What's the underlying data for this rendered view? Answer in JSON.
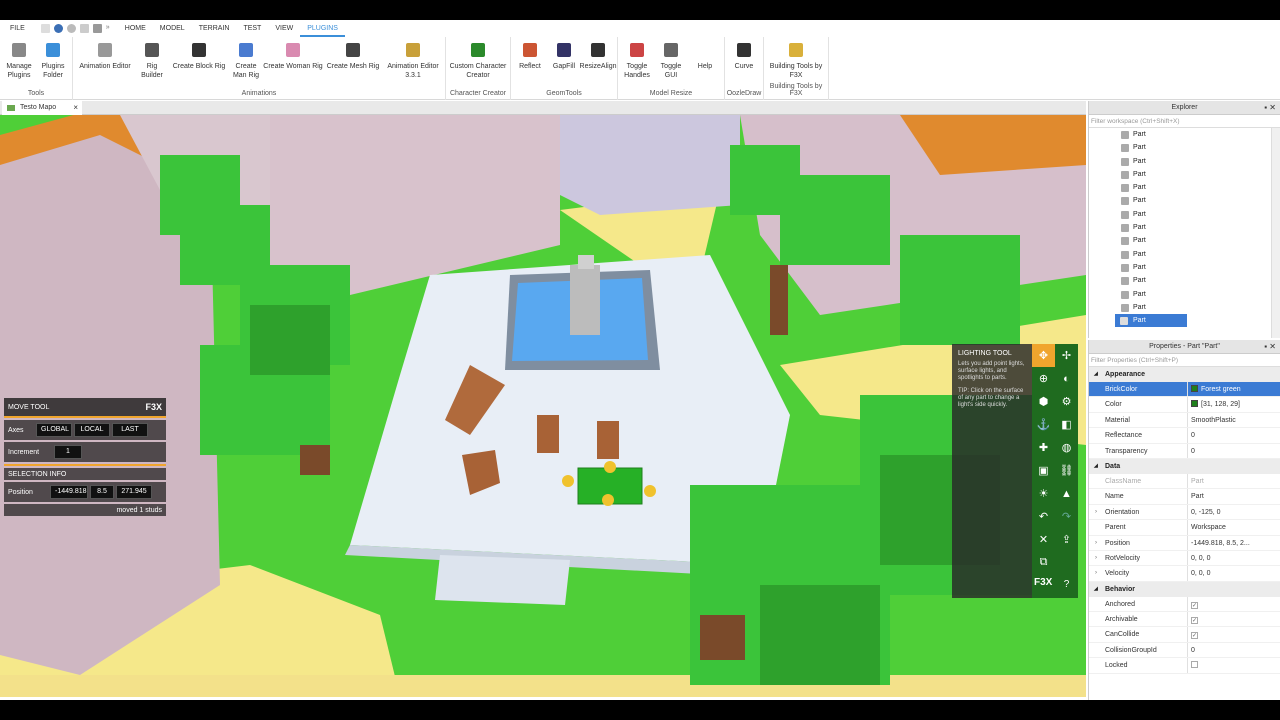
{
  "menu": {
    "file": "FILE",
    "tabs": [
      "HOME",
      "MODEL",
      "TERRAIN",
      "TEST",
      "VIEW",
      "PLUGINS"
    ],
    "active": "PLUGINS"
  },
  "ribbon": {
    "groups": [
      {
        "name": "Tools",
        "buttons": [
          {
            "label": "Manage Plugins",
            "icon": "gear-icon"
          },
          {
            "label": "Plugins Folder",
            "icon": "folder-icon"
          }
        ]
      },
      {
        "name": "Animations",
        "buttons": [
          {
            "label": "Animation Editor",
            "icon": "animation-icon"
          },
          {
            "label": "Rig Builder",
            "icon": "rig-icon"
          },
          {
            "label": "Create Block Rig",
            "icon": "block-rig-icon"
          },
          {
            "label": "Create Man Rig",
            "icon": "man-rig-icon"
          },
          {
            "label": "Create Woman Rig",
            "icon": "woman-rig-icon"
          },
          {
            "label": "Create Mesh Rig",
            "icon": "mesh-rig-icon"
          },
          {
            "label": "Animation Editor 3.3.1",
            "icon": "animation-editor-icon"
          }
        ]
      },
      {
        "name": "Character Creator",
        "buttons": [
          {
            "label": "Custom Character Creator",
            "icon": "character-icon"
          }
        ]
      },
      {
        "name": "GeomTools",
        "buttons": [
          {
            "label": "Reflect",
            "icon": "reflect-icon"
          },
          {
            "label": "GapFill",
            "icon": "gapfill-icon"
          },
          {
            "label": "ResizeAlign",
            "icon": "resize-align-icon"
          }
        ]
      },
      {
        "name": "Model Resize",
        "buttons": [
          {
            "label": "Toggle Handles",
            "icon": "handles-icon"
          },
          {
            "label": "Toggle GUI",
            "icon": "gui-icon"
          },
          {
            "label": "Help",
            "icon": "help-icon"
          }
        ]
      },
      {
        "name": "OozleDraw",
        "buttons": [
          {
            "label": "Curve",
            "icon": "curve-icon"
          }
        ]
      },
      {
        "name": "Building Tools by F3X",
        "buttons": [
          {
            "label": "Building Tools by F3X",
            "icon": "f3x-icon"
          }
        ]
      }
    ]
  },
  "doc_tab": {
    "label": "Testo Mapo",
    "close": "×"
  },
  "move_tool": {
    "title": "MOVE TOOL",
    "brand": "F3X",
    "axes_label": "Axes",
    "axes": [
      "GLOBAL",
      "LOCAL",
      "LAST"
    ],
    "increment_label": "Increment",
    "increment": "1",
    "selection_info": "SELECTION INFO",
    "position_label": "Position",
    "position": [
      "-1449.818",
      "8.5",
      "271.945"
    ],
    "status": "moved 1 studs"
  },
  "lighting_tool": {
    "title": "LIGHTING TOOL",
    "desc": "Lets you add point lights, surface lights, and spotlights to parts.",
    "tip": "TIP: Click on the surface of any part to change a light's side quickly.",
    "brand": "F3X",
    "help": "?"
  },
  "explorer": {
    "title": "Explorer",
    "filter": "Filter workspace (Ctrl+Shift+X)",
    "items": [
      "Part",
      "Part",
      "Part",
      "Part",
      "Part",
      "Part",
      "Part",
      "Part",
      "Part",
      "Part",
      "Part",
      "Part",
      "Part",
      "Part",
      "Part"
    ],
    "selected_index": 14
  },
  "properties": {
    "title": "Properties - Part \"Part\"",
    "filter": "Filter Properties (Ctrl+Shift+P)",
    "sections": [
      {
        "name": "Appearance",
        "rows": [
          {
            "n": "BrickColor",
            "v": "Forest green",
            "swatch": true,
            "sel": true
          },
          {
            "n": "Color",
            "v": "[31, 128, 29]",
            "swatch": true
          },
          {
            "n": "Material",
            "v": "SmoothPlastic"
          },
          {
            "n": "Reflectance",
            "v": "0"
          },
          {
            "n": "Transparency",
            "v": "0"
          }
        ]
      },
      {
        "name": "Data",
        "rows": [
          {
            "n": "ClassName",
            "v": "Part",
            "dim": true
          },
          {
            "n": "Name",
            "v": "Part"
          },
          {
            "n": "Orientation",
            "v": "0, -125, 0",
            "exp": true
          },
          {
            "n": "Parent",
            "v": "Workspace"
          },
          {
            "n": "Position",
            "v": "-1449.818, 8.5, 2...",
            "exp": true
          },
          {
            "n": "RotVelocity",
            "v": "0, 0, 0",
            "exp": true
          },
          {
            "n": "Velocity",
            "v": "0, 0, 0",
            "exp": true
          }
        ]
      },
      {
        "name": "Behavior",
        "rows": [
          {
            "n": "Anchored",
            "chk": true
          },
          {
            "n": "Archivable",
            "chk": true
          },
          {
            "n": "CanCollide",
            "chk": true
          },
          {
            "n": "CollisionGroupId",
            "v": "0"
          },
          {
            "n": "Locked",
            "chk": false
          }
        ]
      }
    ]
  },
  "colors": {
    "accent": "#3b8fd9",
    "f3x_orange": "#f0a52d",
    "grass": "#4fd03a",
    "forest_green": "#1f801c"
  }
}
